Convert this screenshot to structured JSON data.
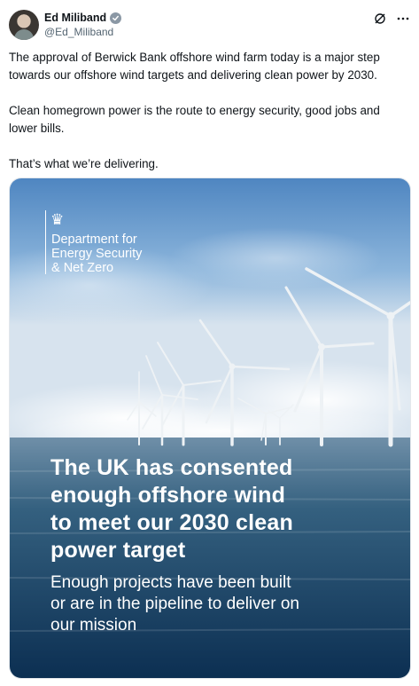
{
  "author": {
    "name": "Ed Miliband",
    "handle": "@Ed_Miliband",
    "verified_icon": "verified-badge-icon"
  },
  "actions": {
    "grok_icon": "slash-circle-icon",
    "more_icon": "more-icon"
  },
  "post": {
    "paragraphs": [
      "The approval of Berwick Bank offshore wind farm today is a major step towards our offshore wind targets and delivering clean power by 2030.",
      "Clean homegrown power is the route to energy security, good jobs and lower bills.",
      "That’s what we’re delivering."
    ]
  },
  "media": {
    "dept_name": "Department for\nEnergy Security\n& Net Zero",
    "headline": "The UK has consented\nenough offshore wind\nto meet our 2030 clean\npower target",
    "subheadline": "Enough projects have been built\nor are in the pipeline to deliver on\nour mission",
    "colors": {
      "sky_top": "#5d8fc5",
      "sea": "#16456e"
    }
  }
}
